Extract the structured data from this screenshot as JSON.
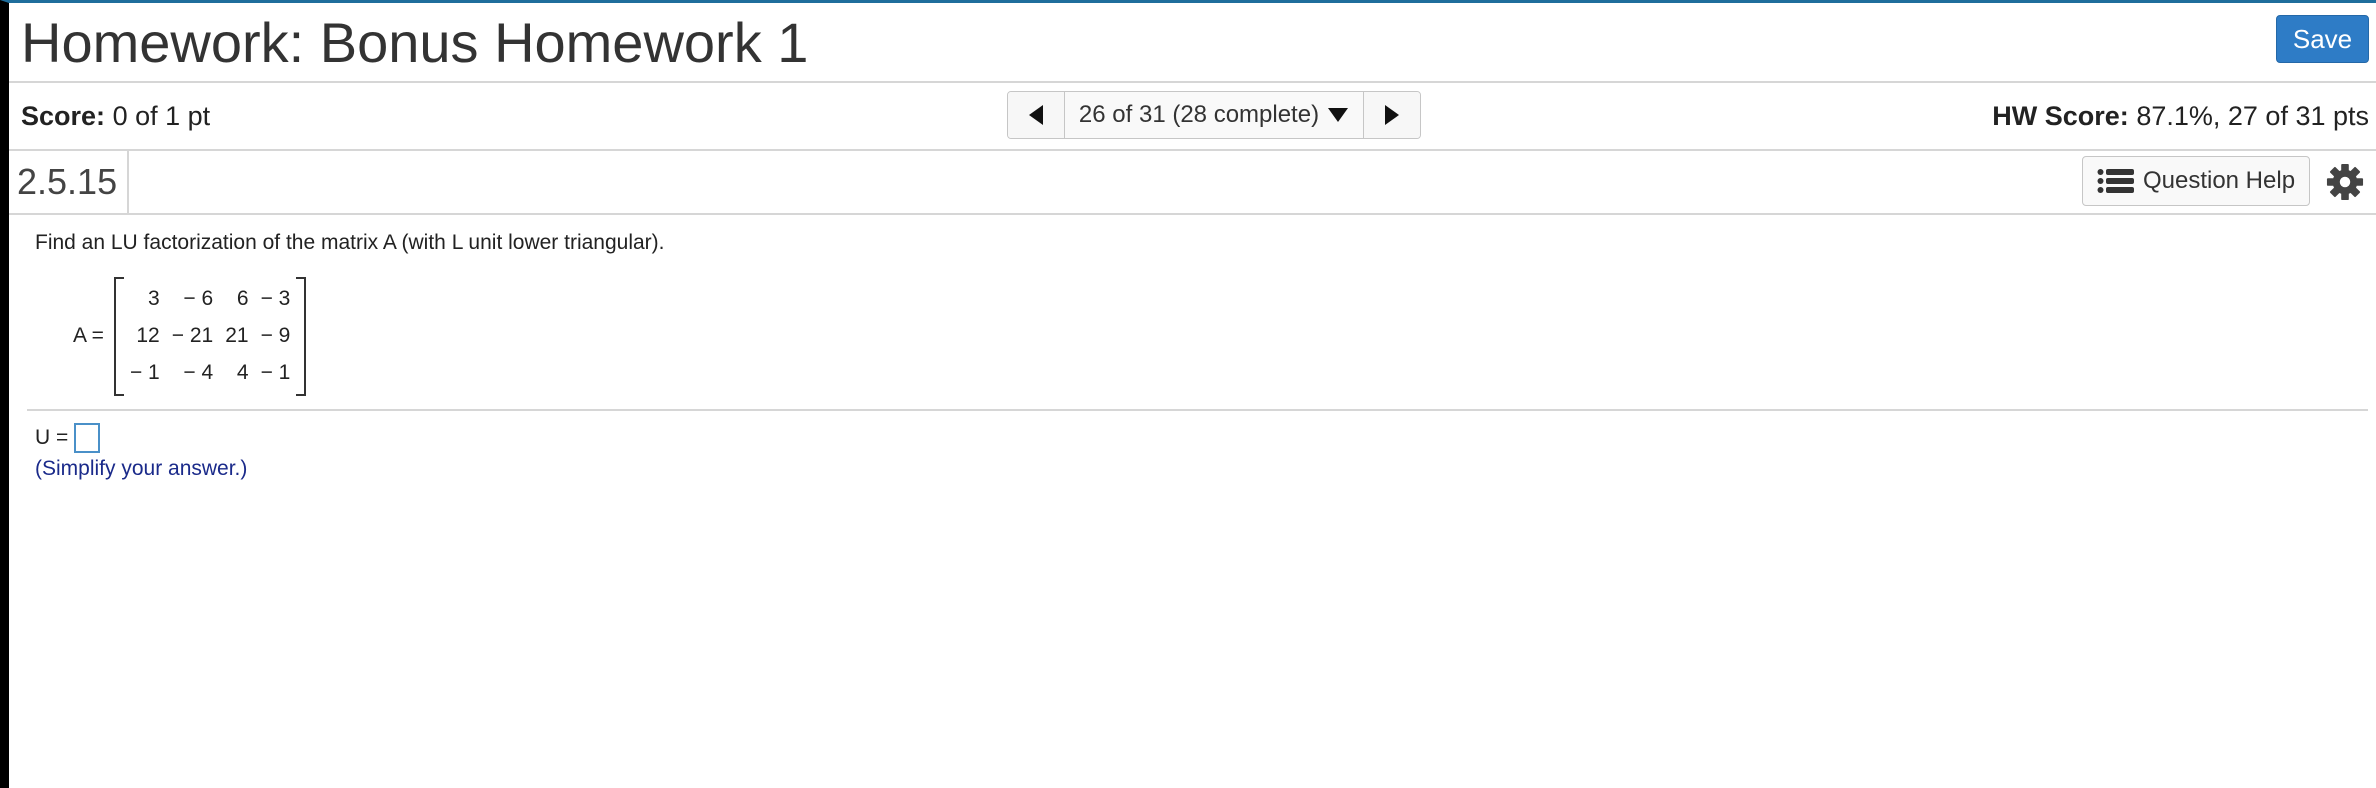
{
  "header": {
    "title": "Homework: Bonus Homework 1",
    "save_label": "Save"
  },
  "scorebar": {
    "score_label": "Score:",
    "score_value": "0 of 1 pt",
    "nav_label": "26 of 31 (28 complete)",
    "hw_score_label": "HW Score:",
    "hw_score_value": "87.1%, 27 of 31 pts"
  },
  "question": {
    "number": "2.5.15",
    "help_label": "Question Help"
  },
  "content": {
    "instruction": "Find an LU factorization of the matrix A (with L unit lower triangular).",
    "matrix_label": "A =",
    "matrix_rows": [
      [
        "3",
        "− 6",
        "6",
        "− 3"
      ],
      [
        "12",
        "− 21",
        "21",
        "− 9"
      ],
      [
        "− 1",
        "− 4",
        "4",
        "− 1"
      ]
    ],
    "answer_label": "U =",
    "hint": "(Simplify your answer.)"
  },
  "colors": {
    "accent": "#2e7cc6",
    "top_border": "#1f6e9c",
    "hint_text": "#1a2a8a"
  },
  "icons": {
    "prev": "triangle-left-icon",
    "next": "triangle-right-icon",
    "dropdown": "caret-down-icon",
    "help": "list-icon",
    "settings": "gear-icon"
  }
}
